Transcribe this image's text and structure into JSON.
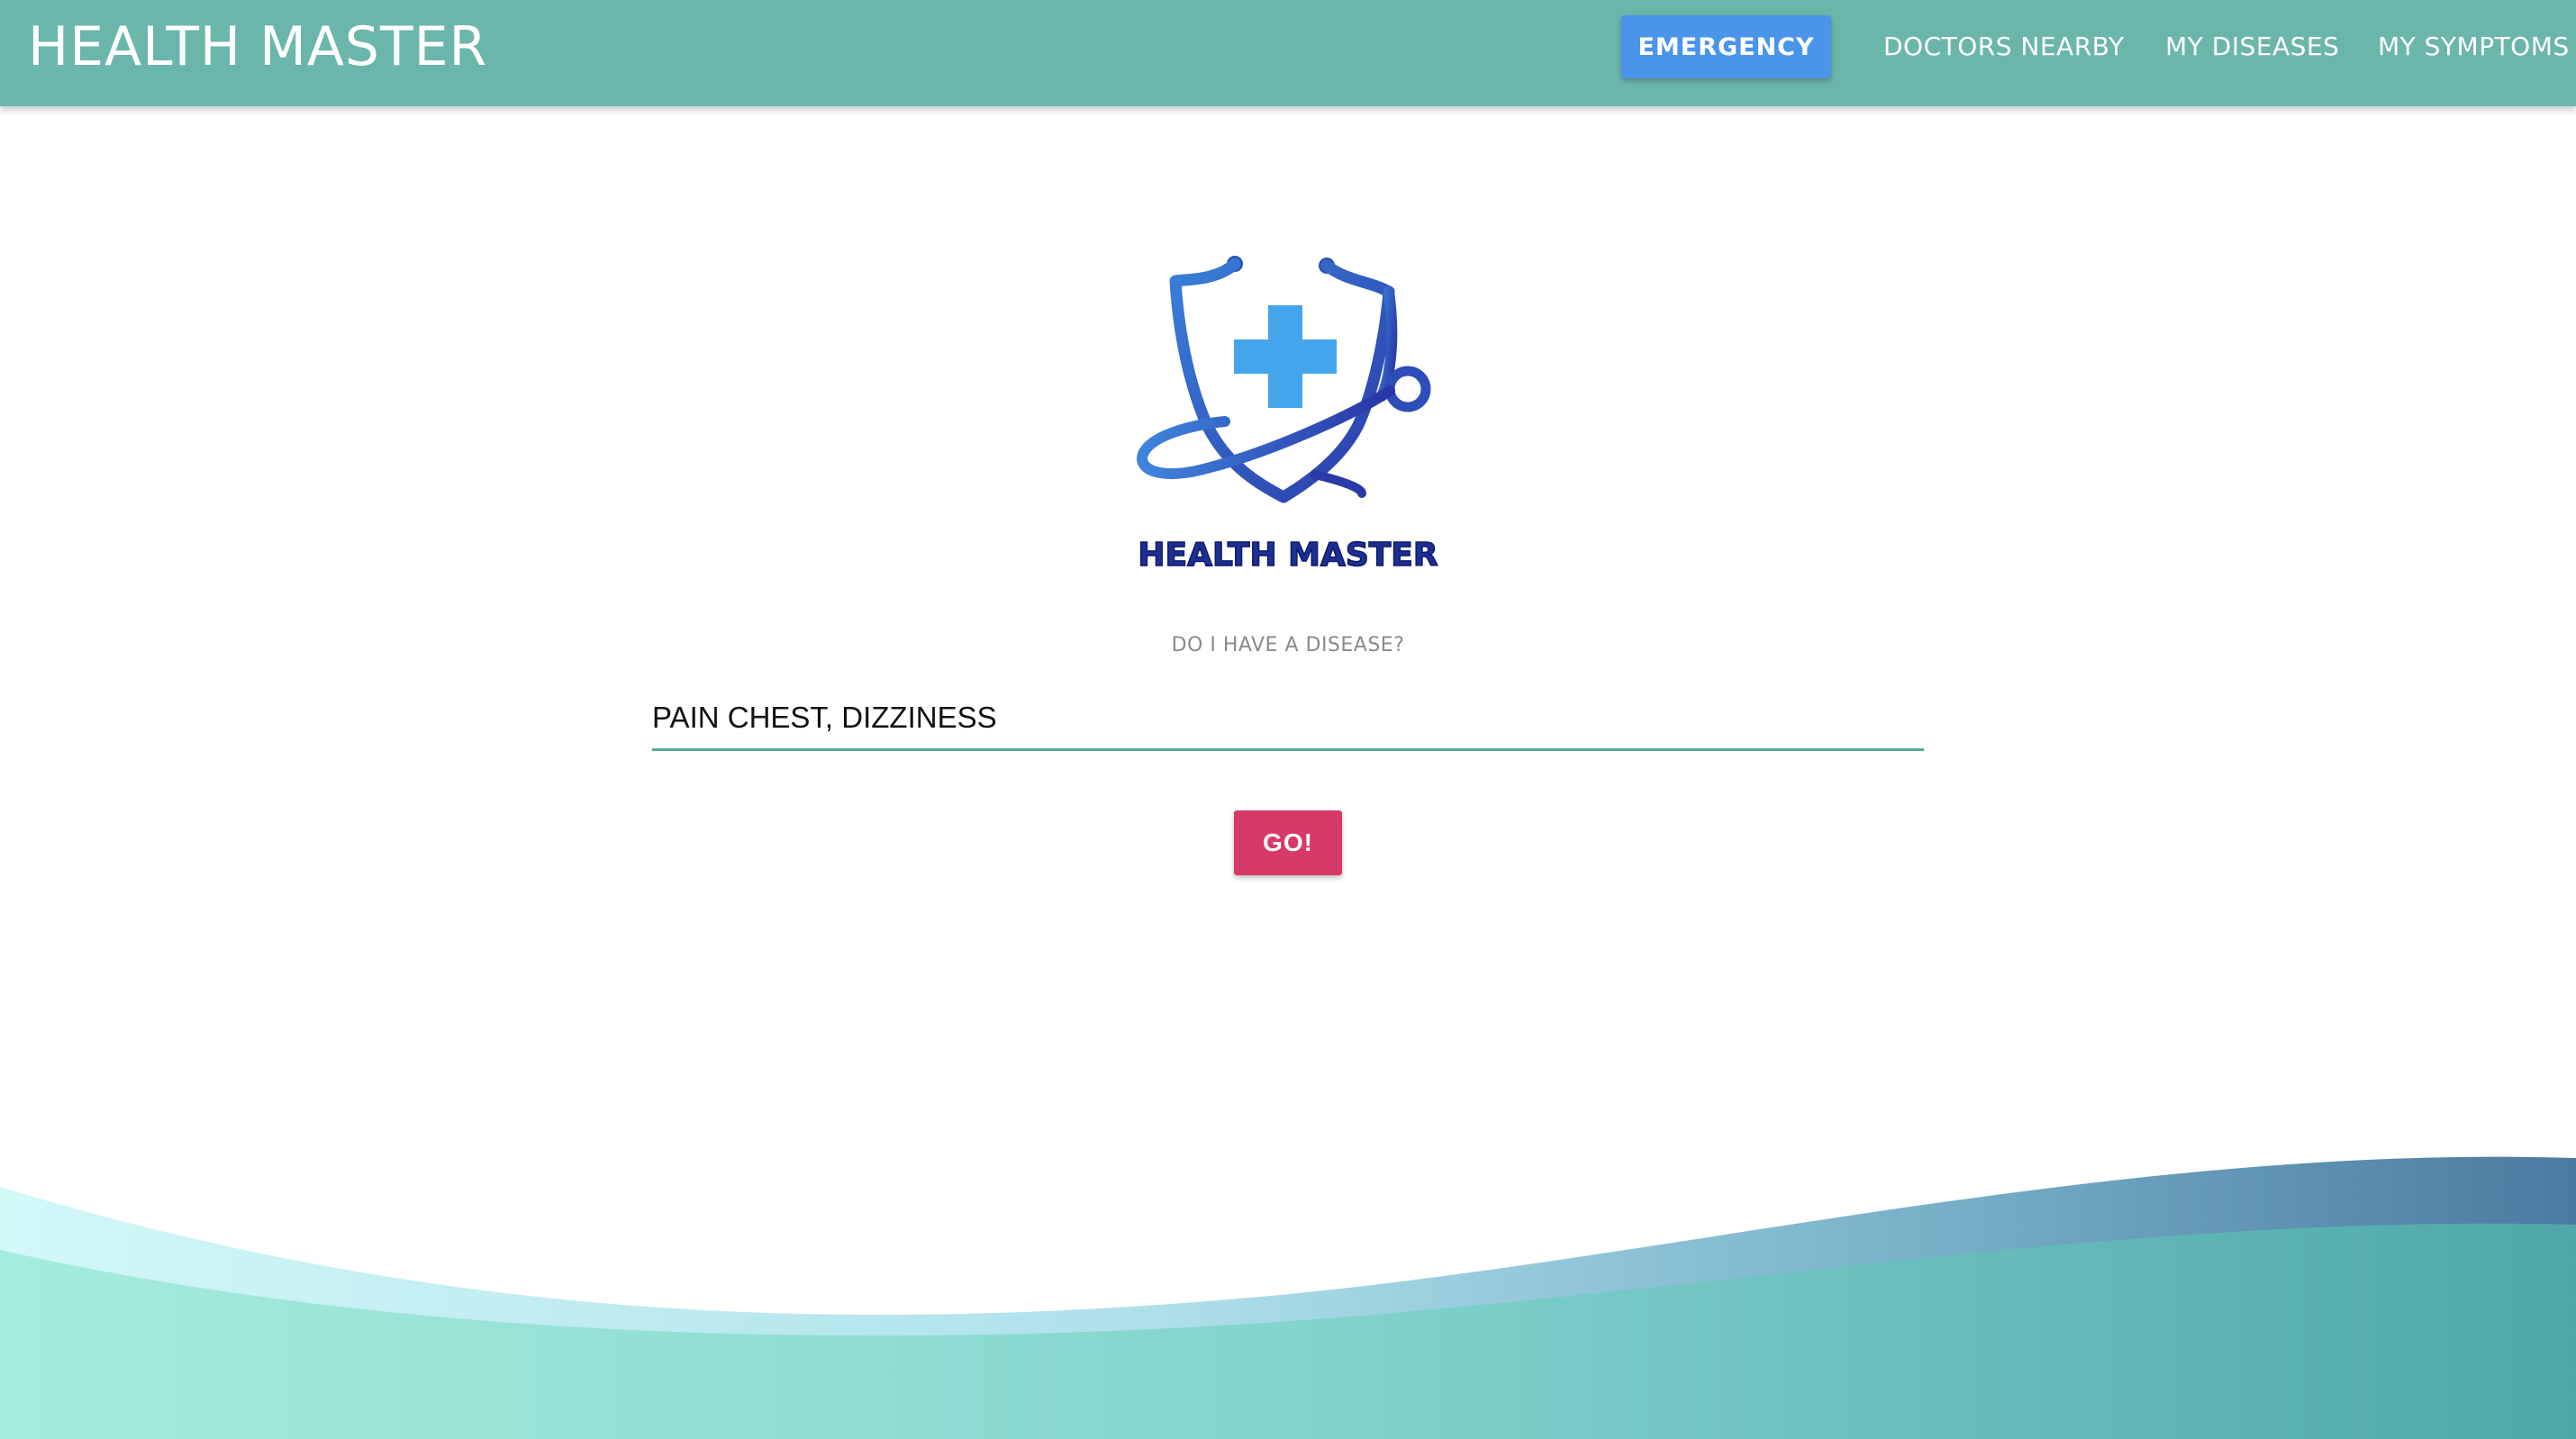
{
  "header": {
    "brand": "HEALTH MASTER",
    "emergency_label": "EMERGENCY",
    "nav": [
      {
        "label": "DOCTORS NEARBY"
      },
      {
        "label": "MY DISEASES"
      },
      {
        "label": "MY SYMPTOMS"
      }
    ]
  },
  "logo": {
    "icon": "shield-stethoscope-cross-icon",
    "text": "HEALTH MASTER"
  },
  "search": {
    "label": "DO I HAVE A DISEASE?",
    "value": "PAIN CHEST, DIZZINESS",
    "button_label": "GO!"
  },
  "colors": {
    "header": "#6bb6ab",
    "emergency": "#4a95ea",
    "go_button": "#d73a66",
    "input_underline": "#5ba89b",
    "logo_blue": "#1e2f93",
    "cross": "#44a4ec"
  }
}
